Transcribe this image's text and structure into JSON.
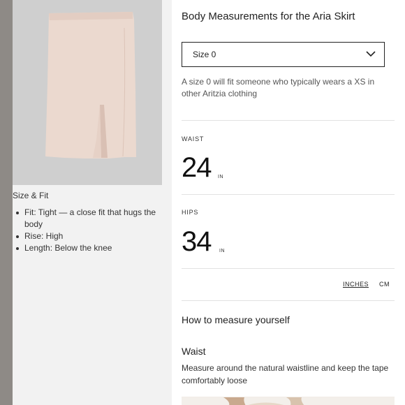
{
  "left": {
    "size_fit_title": "Size & Fit",
    "fit_items": [
      "Fit: Tight — a close fit that hugs the body",
      "Rise: High",
      "Length: Below the knee"
    ]
  },
  "sheet": {
    "title": "Body Measurements for the Aria Skirt",
    "size_select_value": "Size 0",
    "size_note": "A size 0 will fit someone who typically wears a XS in other Aritzia clothing"
  },
  "measurements": [
    {
      "label": "WAIST",
      "value": "24",
      "unit": "IN"
    },
    {
      "label": "HIPS",
      "value": "34",
      "unit": "IN"
    }
  ],
  "units": {
    "inches": "INCHES",
    "cm": "CM"
  },
  "howto": {
    "title": "How to measure yourself",
    "waist_title": "Waist",
    "waist_desc": "Measure around the natural waistline and keep the tape comfortably loose"
  },
  "colors": {
    "skirt": "#ead6cc",
    "image_bg": "#cfcfcf",
    "panel_bg": "#f2f2f2"
  }
}
